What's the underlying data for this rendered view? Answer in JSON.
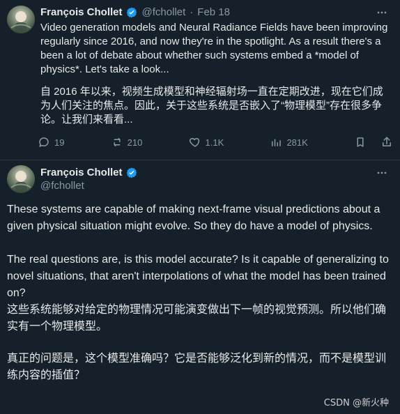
{
  "tweet1": {
    "author_name": "François Chollet",
    "handle": "@fchollet",
    "separator": "·",
    "date": "Feb 18",
    "text_en": "Video generation models and Neural Radiance Fields have been improving regularly since 2016, and now they're in the spotlight. As a result there's a been a lot of debate about whether such systems embed a *model of physics*. Let's take a look...",
    "text_zh": "自 2016 年以来，视频生成模型和神经辐射场一直在定期改进，现在它们成为人们关注的焦点。因此，关于这些系统是否嵌入了“物理模型”存在很多争论。让我们来看看...",
    "actions": {
      "replies": "19",
      "reposts": "210",
      "likes": "1.1K",
      "views": "281K"
    },
    "icons": {
      "more": "more-horizontal-icon",
      "reply": "reply-icon",
      "repost": "repost-icon",
      "like": "heart-icon",
      "views": "views-chart-icon",
      "bookmark": "bookmark-icon",
      "share": "share-upload-icon",
      "verified": "verified-badge-icon"
    }
  },
  "tweet2": {
    "author_name": "François Chollet",
    "handle": "@fchollet",
    "p1": "These systems are capable of making next-frame visual predictions about a given physical situation might evolve. So they do have a model of physics.",
    "p2": "The real questions are, is this model accurate? Is it capable of generalizing to novel situations, that aren't interpolations of what the model has been trained on?",
    "p3": "这些系统能够对给定的物理情况可能演变做出下一帧的视觉预测。所以他们确实有一个物理模型。",
    "p4": "真正的问题是，这个模型准确吗？它是否能够泛化到新的情况，而不是模型训练内容的插值？",
    "icons": {
      "more": "more-horizontal-icon",
      "verified": "verified-badge-icon"
    }
  },
  "watermark": "CSDN @新火种",
  "colors": {
    "background": "#15202b",
    "text": "#e7e9ea",
    "muted": "#8b98a5",
    "verified": "#1d9bf0"
  }
}
